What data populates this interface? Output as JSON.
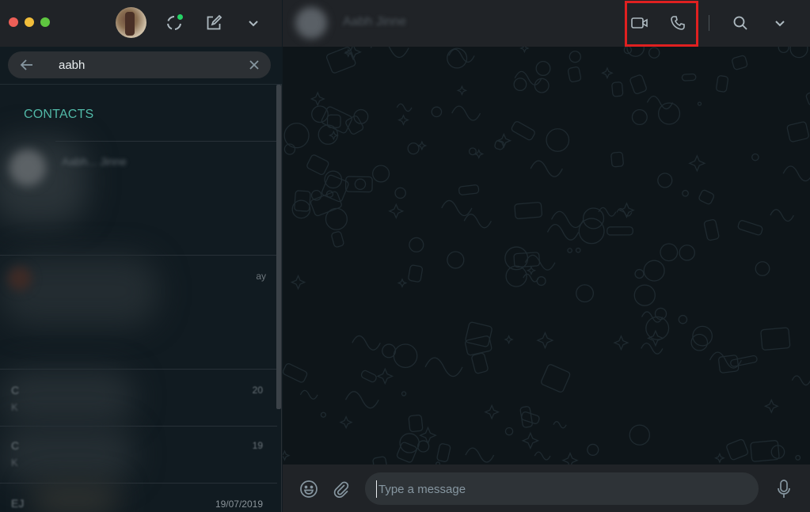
{
  "window": {
    "controls": [
      "close",
      "minimize",
      "zoom"
    ]
  },
  "sidebar": {
    "header": {
      "icons": [
        "profile-avatar",
        "status-icon",
        "new-chat-icon",
        "menu-chevron-icon"
      ]
    },
    "search": {
      "value": "aabh",
      "back_icon": "arrow-left-icon",
      "clear_icon": "close-icon"
    },
    "results": {
      "section_label": "CONTACTS",
      "contacts": [
        {
          "name": "Aabh... Jinne",
          "avatar": "blurred"
        }
      ],
      "chats": [
        {
          "title": "",
          "subtitle": "",
          "date": "ay"
        },
        {
          "title": "C",
          "subtitle": "K",
          "date": "20"
        },
        {
          "title": "C",
          "subtitle": "K",
          "date": "19"
        },
        {
          "title": "EJ",
          "subtitle": "",
          "date": "19/07/2019"
        }
      ]
    }
  },
  "chat": {
    "header": {
      "contact_name": "Aabh Jinne",
      "icons": [
        "video-call-icon",
        "voice-call-icon",
        "search-icon",
        "menu-chevron-icon"
      ]
    },
    "highlight_color": "#e02020",
    "composer": {
      "placeholder": "Type a message",
      "value": "",
      "icons": [
        "emoji-icon",
        "attach-icon",
        "microphone-icon"
      ]
    }
  },
  "colors": {
    "accent": "#53bdab",
    "header_bg": "#202327",
    "sidebar_bg": "#111b21",
    "chat_bg": "#0c1317",
    "status_dot": "#25d366"
  }
}
